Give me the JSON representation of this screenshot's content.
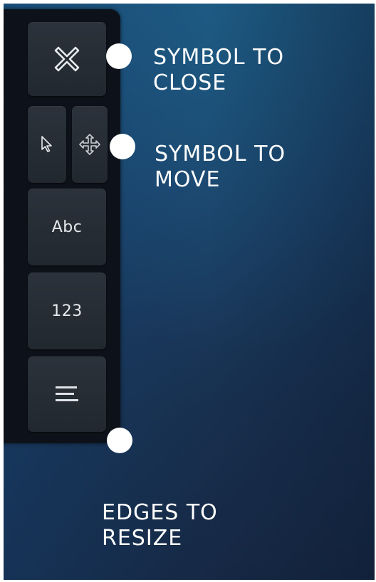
{
  "keyboard": {
    "keys": {
      "close_icon": "close-icon",
      "pointer_icon": "pointer-icon",
      "move_icon": "move-icon",
      "abc_label": "Abc",
      "numbers_label": "123",
      "menu_icon": "menu-icon"
    }
  },
  "annotations": {
    "close": {
      "line1": "SYMBOL TO",
      "line2": "CLOSE"
    },
    "move": {
      "line1": "SYMBOL TO",
      "line2": "MOVE"
    },
    "resize": {
      "line1": "EDGES TO",
      "line2": "RESIZE"
    }
  },
  "colors": {
    "panel": "#0d121a",
    "key": "#262c34",
    "background_top": "#1c4f78",
    "background_bottom": "#162844",
    "annotation": "#ffffff"
  }
}
